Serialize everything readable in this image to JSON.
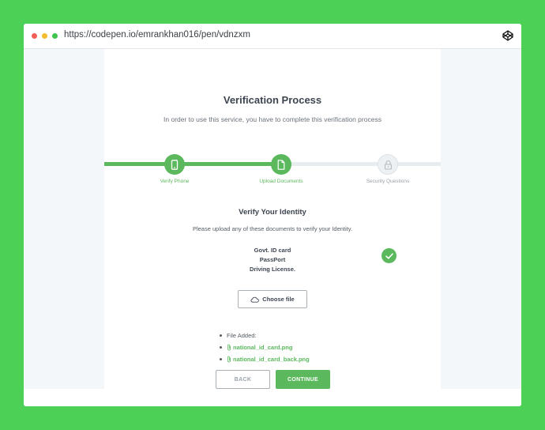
{
  "browser": {
    "url": "https://codepen.io/emrankhan016/pen/vdnzxm",
    "icon": "codepen-icon"
  },
  "header": {
    "title": "Verification Process",
    "subtitle": "In order to use this service, you have to complete this verification process"
  },
  "steps": [
    {
      "label": "Verify Phone",
      "icon": "phone-icon",
      "status": "complete"
    },
    {
      "label": "Upload Documents",
      "icon": "document-icon",
      "status": "complete"
    },
    {
      "label": "Security Questions",
      "icon": "lock-icon",
      "status": "pending"
    }
  ],
  "progress_fraction": 0.5,
  "verify": {
    "title": "Verify Your Identity",
    "instructions": "Please upload any of these documents to verify your Identity.",
    "documents": [
      "Govt. ID card",
      "PassPort",
      "Driving License."
    ],
    "choose_file_label": "Choose file"
  },
  "files": {
    "heading": "File Added:",
    "items": [
      "national_id_card.png",
      "national_id_card_back.png"
    ]
  },
  "actions": {
    "back_label": "BACK",
    "continue_label": "CONTINUE"
  },
  "colors": {
    "accent": "#5bb85d",
    "page_background": "#4cd055"
  }
}
